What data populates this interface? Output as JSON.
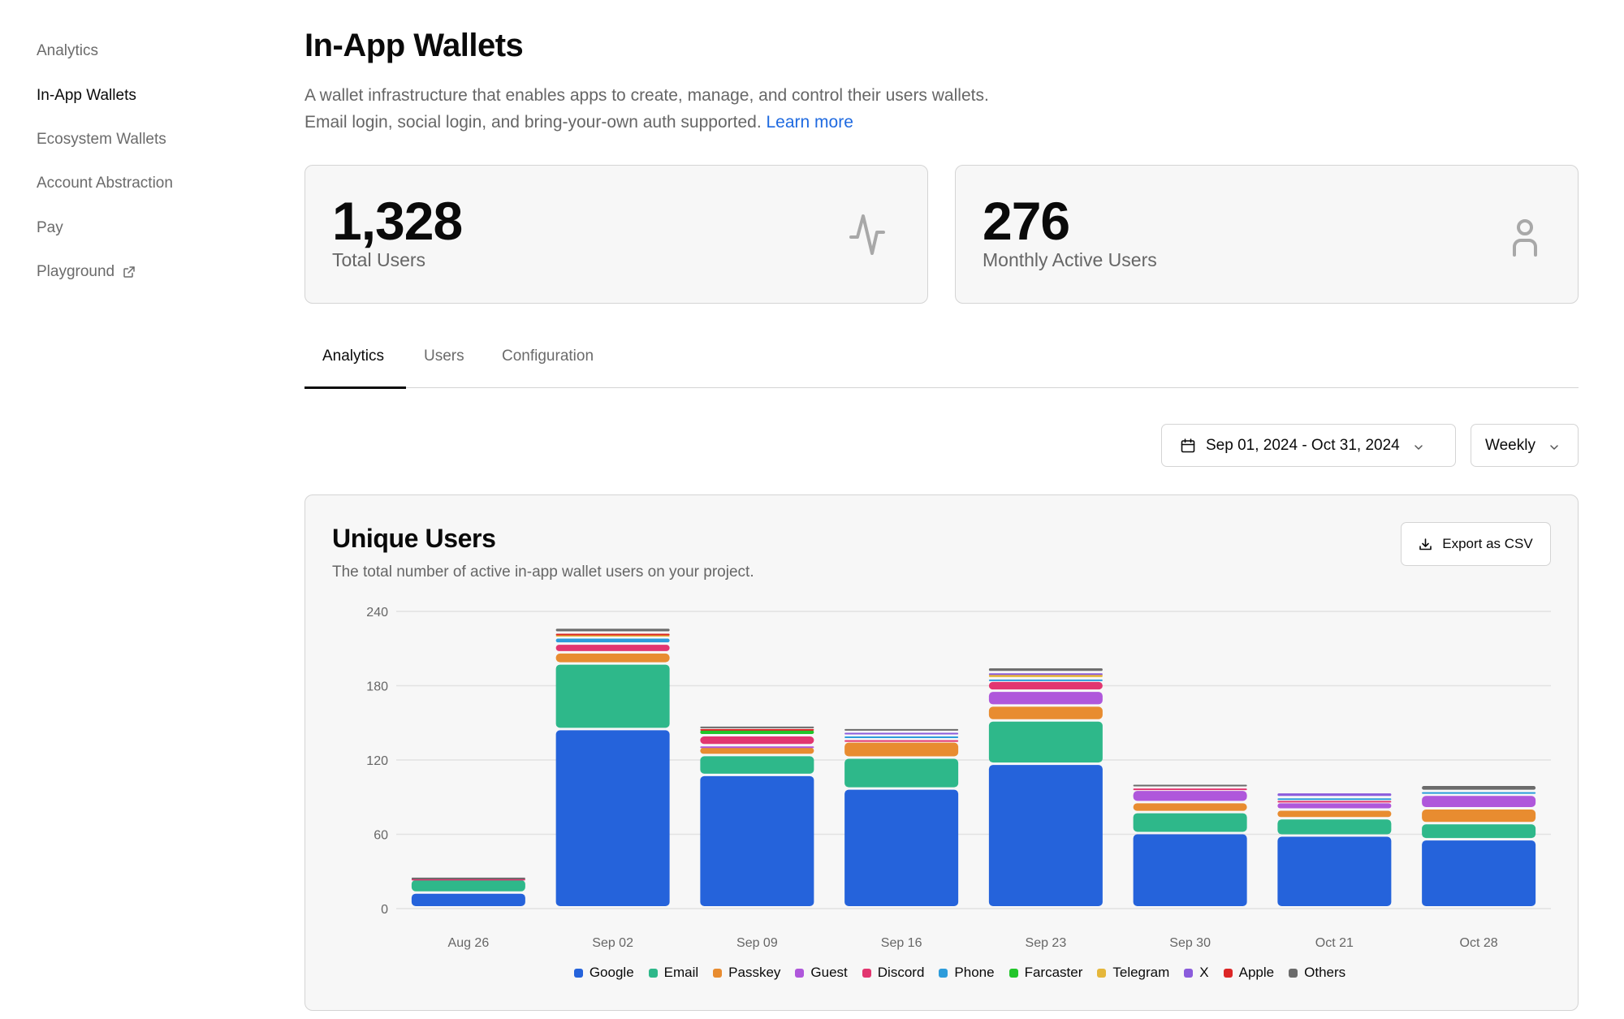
{
  "sidebar": {
    "items": [
      {
        "label": "Analytics",
        "active": false
      },
      {
        "label": "In-App Wallets",
        "active": true
      },
      {
        "label": "Ecosystem Wallets",
        "active": false
      },
      {
        "label": "Account Abstraction",
        "active": false
      },
      {
        "label": "Pay",
        "active": false
      },
      {
        "label": "Playground",
        "active": false,
        "icon": "external-link-icon"
      }
    ]
  },
  "header": {
    "title": "In-App Wallets",
    "description_line1": "A wallet infrastructure that enables apps to create, manage, and control their users wallets.",
    "description_line2": "Email login, social login, and bring-your-own auth supported.",
    "learn_more": "Learn more"
  },
  "stats": [
    {
      "value": "1,328",
      "label": "Total Users",
      "icon": "activity-icon"
    },
    {
      "value": "276",
      "label": "Monthly Active Users",
      "icon": "user-icon"
    }
  ],
  "tabs": [
    {
      "label": "Analytics",
      "active": true
    },
    {
      "label": "Users",
      "active": false
    },
    {
      "label": "Configuration",
      "active": false
    }
  ],
  "filters": {
    "date_range": "Sep 01, 2024 - Oct 31, 2024",
    "period": "Weekly"
  },
  "chart_card": {
    "title": "Unique Users",
    "subtitle": "The total number of active in-app wallet users on your project.",
    "export_label": "Export as CSV"
  },
  "chart_data": {
    "type": "bar",
    "stacked": true,
    "title": "Unique Users",
    "xlabel": "",
    "ylabel": "",
    "ylim": [
      0,
      240
    ],
    "yticks": [
      0,
      60,
      120,
      180,
      240
    ],
    "grid": true,
    "legend_position": "bottom",
    "categories": [
      "Aug 26",
      "Sep 02",
      "Sep 09",
      "Sep 16",
      "Sep 23",
      "Sep 30",
      "Oct 21",
      "Oct 28"
    ],
    "series": [
      {
        "name": "Google",
        "color": "#2563db",
        "values": [
          12,
          144,
          107,
          96,
          116,
          60,
          58,
          55
        ]
      },
      {
        "name": "Email",
        "color": "#2eb88a",
        "values": [
          11,
          53,
          16,
          25,
          35,
          17,
          14,
          13
        ]
      },
      {
        "name": "Passkey",
        "color": "#e88c30",
        "values": [
          0,
          9,
          7,
          13,
          12,
          8,
          7,
          12
        ]
      },
      {
        "name": "Guest",
        "color": "#af57db",
        "values": [
          0,
          0,
          1,
          0,
          12,
          10,
          6,
          11
        ]
      },
      {
        "name": "Discord",
        "color": "#e23670",
        "values": [
          1,
          7,
          8,
          2,
          8,
          2,
          2,
          0
        ]
      },
      {
        "name": "Phone",
        "color": "#2d9cdb",
        "values": [
          0,
          5,
          0,
          3,
          2,
          0,
          2,
          3
        ]
      },
      {
        "name": "Farcaster",
        "color": "#22c52a",
        "values": [
          0,
          0,
          5,
          0,
          0,
          0,
          0,
          0
        ]
      },
      {
        "name": "Telegram",
        "color": "#e5b73b",
        "values": [
          0,
          3,
          0,
          0,
          4,
          0,
          0,
          0
        ]
      },
      {
        "name": "X",
        "color": "#8b5cdc",
        "values": [
          0,
          0,
          0,
          3,
          1,
          0,
          4,
          0
        ]
      },
      {
        "name": "Apple",
        "color": "#dc2626",
        "values": [
          0,
          1,
          1,
          0,
          0,
          0,
          0,
          0
        ]
      },
      {
        "name": "Others",
        "color": "#6b6b6b",
        "values": [
          1,
          4,
          2,
          3,
          4,
          3,
          0,
          5
        ]
      }
    ]
  }
}
